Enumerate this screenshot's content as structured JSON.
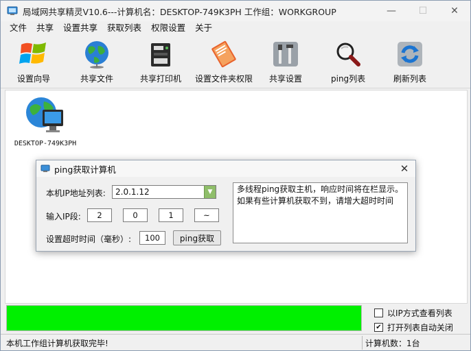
{
  "window": {
    "title": "局域网共享精灵V10.6---计算机名：DESKTOP-749K3PH  工作组：WORKGROUP",
    "minimize_glyph": "—",
    "maximize_glyph": "☐",
    "close_glyph": "✕"
  },
  "menu": [
    "文件",
    "共享",
    "设置共享",
    "获取列表",
    "权限设置",
    "关于"
  ],
  "toolbar": [
    {
      "label": "设置向导",
      "icon": "windows-logo-icon"
    },
    {
      "label": "共享文件",
      "icon": "globe-icon"
    },
    {
      "label": "共享打印机",
      "icon": "printer-icon"
    },
    {
      "label": "设置文件夹权限",
      "icon": "folder-book-icon"
    },
    {
      "label": "共享设置",
      "icon": "tools-icon"
    },
    {
      "label": "ping列表",
      "icon": "magnifier-icon"
    },
    {
      "label": "刷新列表",
      "icon": "refresh-icon"
    }
  ],
  "computers": [
    {
      "name": "DESKTOP-749K3PH",
      "icon": "network-computer-icon"
    }
  ],
  "dialog": {
    "title": "ping获取计算机",
    "ip_list_label": "本机IP地址列表:",
    "ip_list_value": "2.0.1.12",
    "ip_segment_label": "输入IP段:",
    "ip_parts": [
      "2",
      "0",
      "1",
      "~"
    ],
    "timeout_label": "设置超时时间（毫秒）:",
    "timeout_value": "100",
    "ping_button": "ping获取",
    "message": "多线程ping获取主机，响应时间将在栏显示。如果有些计算机获取不到，请增大超时时间",
    "close_glyph": "✕"
  },
  "progress": {
    "value": 1.0,
    "color": "#00f000"
  },
  "options": [
    {
      "label": "以IP方式查看列表",
      "checked": false
    },
    {
      "label": "打开列表自动关闭",
      "checked": true
    }
  ],
  "status": {
    "left": "本机工作组计算机获取完毕!",
    "right": "计算机数：1台"
  }
}
